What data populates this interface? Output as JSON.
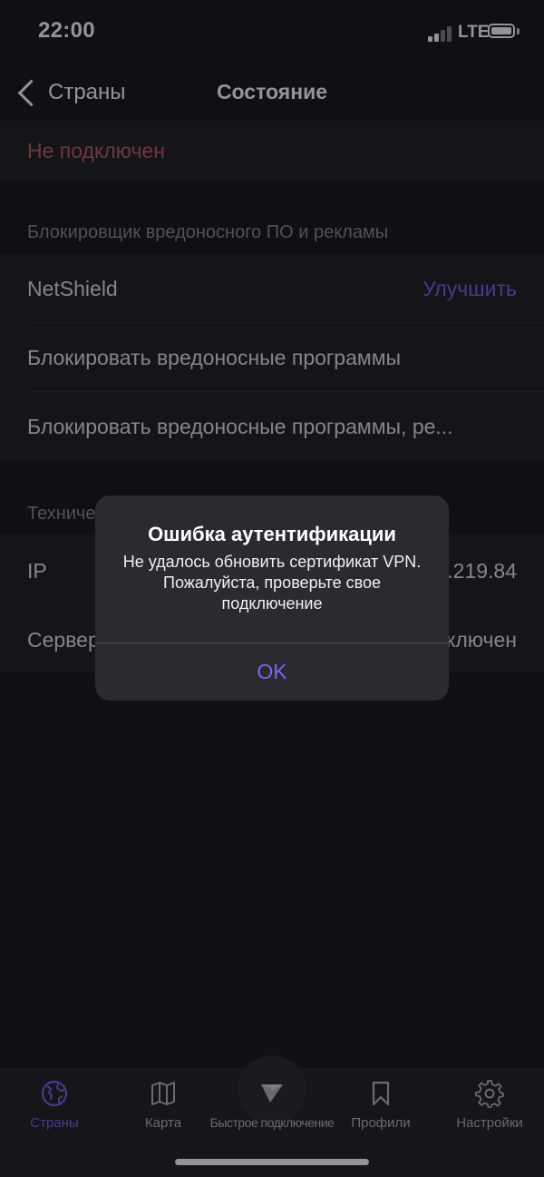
{
  "status_bar": {
    "time": "22:00",
    "network": "LTE"
  },
  "nav": {
    "back_label": "Страны",
    "title": "Состояние"
  },
  "connection": {
    "status": "Не подключен",
    "status_color": "#c0606a"
  },
  "blocker_section": {
    "header": "Блокировщик вредоносного ПО и рекламы",
    "netshield_label": "NetShield",
    "upgrade_label": "Улучшить",
    "options": [
      "Блокировать вредоносные программы",
      "Блокировать вредоносные программы, ре..."
    ]
  },
  "tech_section": {
    "header": "Техничес",
    "rows": [
      {
        "label": "IP",
        "value": "5.219.84"
      },
      {
        "label": "Сервер",
        "value": "ключен"
      }
    ]
  },
  "alert": {
    "title": "Ошибка аутентификации",
    "message": "Не удалось обновить сертификат VPN. Пожалуйста, проверьте свое подключение",
    "ok_label": "OK"
  },
  "tab_bar": {
    "items": [
      {
        "label": "Страны",
        "icon": "globe-icon",
        "active": true
      },
      {
        "label": "Карта",
        "icon": "map-icon",
        "active": false
      },
      {
        "label": "Быстрое подключение",
        "icon": "quick-connect-icon",
        "active": false
      },
      {
        "label": "Профили",
        "icon": "bookmark-icon",
        "active": false
      },
      {
        "label": "Настройки",
        "icon": "gear-icon",
        "active": false
      }
    ]
  },
  "colors": {
    "accent": "#7b66f0",
    "background": "#1c1b22",
    "row_background": "#25242c"
  }
}
